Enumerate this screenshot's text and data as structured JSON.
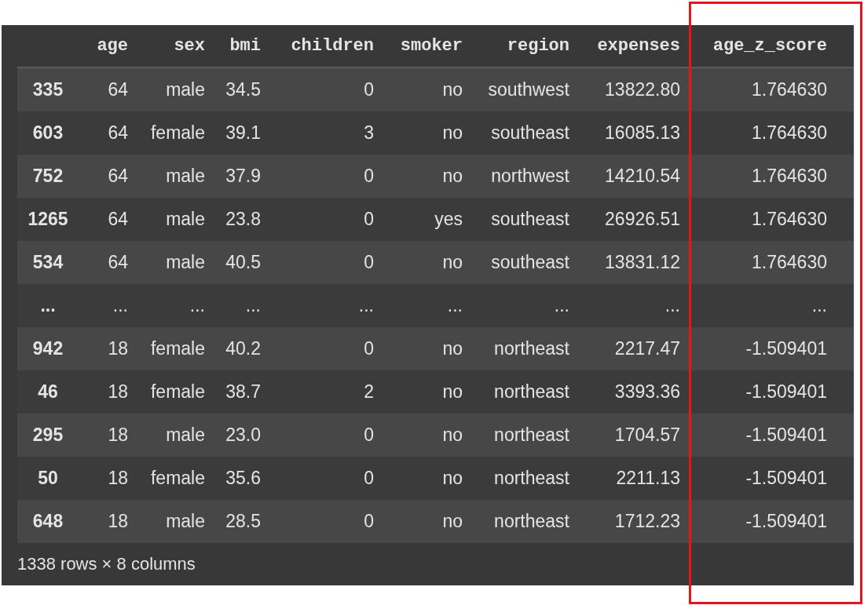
{
  "table": {
    "columns": [
      {
        "label": "age",
        "highlighted": false
      },
      {
        "label": "sex",
        "highlighted": false
      },
      {
        "label": "bmi",
        "highlighted": false
      },
      {
        "label": "children",
        "highlighted": false
      },
      {
        "label": "smoker",
        "highlighted": false
      },
      {
        "label": "region",
        "highlighted": false
      },
      {
        "label": "expenses",
        "highlighted": false
      },
      {
        "label": "age_z_score",
        "highlighted": true
      }
    ],
    "rows": [
      {
        "index": "335",
        "cells": [
          "64",
          "male",
          "34.5",
          "0",
          "no",
          "southwest",
          "13822.80",
          "1.764630"
        ]
      },
      {
        "index": "603",
        "cells": [
          "64",
          "female",
          "39.1",
          "3",
          "no",
          "southeast",
          "16085.13",
          "1.764630"
        ]
      },
      {
        "index": "752",
        "cells": [
          "64",
          "male",
          "37.9",
          "0",
          "no",
          "northwest",
          "14210.54",
          "1.764630"
        ]
      },
      {
        "index": "1265",
        "cells": [
          "64",
          "male",
          "23.8",
          "0",
          "yes",
          "southeast",
          "26926.51",
          "1.764630"
        ]
      },
      {
        "index": "534",
        "cells": [
          "64",
          "male",
          "40.5",
          "0",
          "no",
          "southeast",
          "13831.12",
          "1.764630"
        ]
      },
      {
        "index": "...",
        "cells": [
          "...",
          "...",
          "...",
          "...",
          "...",
          "...",
          "...",
          "..."
        ]
      },
      {
        "index": "942",
        "cells": [
          "18",
          "female",
          "40.2",
          "0",
          "no",
          "northeast",
          "2217.47",
          "-1.509401"
        ]
      },
      {
        "index": "46",
        "cells": [
          "18",
          "female",
          "38.7",
          "2",
          "no",
          "northeast",
          "3393.36",
          "-1.509401"
        ]
      },
      {
        "index": "295",
        "cells": [
          "18",
          "male",
          "23.0",
          "0",
          "no",
          "northeast",
          "1704.57",
          "-1.509401"
        ]
      },
      {
        "index": "50",
        "cells": [
          "18",
          "female",
          "35.6",
          "0",
          "no",
          "northeast",
          "2211.13",
          "-1.509401"
        ]
      },
      {
        "index": "648",
        "cells": [
          "18",
          "male",
          "28.5",
          "0",
          "no",
          "northeast",
          "1712.23",
          "-1.509401"
        ]
      }
    ],
    "footer": "1338 rows × 8 columns"
  }
}
